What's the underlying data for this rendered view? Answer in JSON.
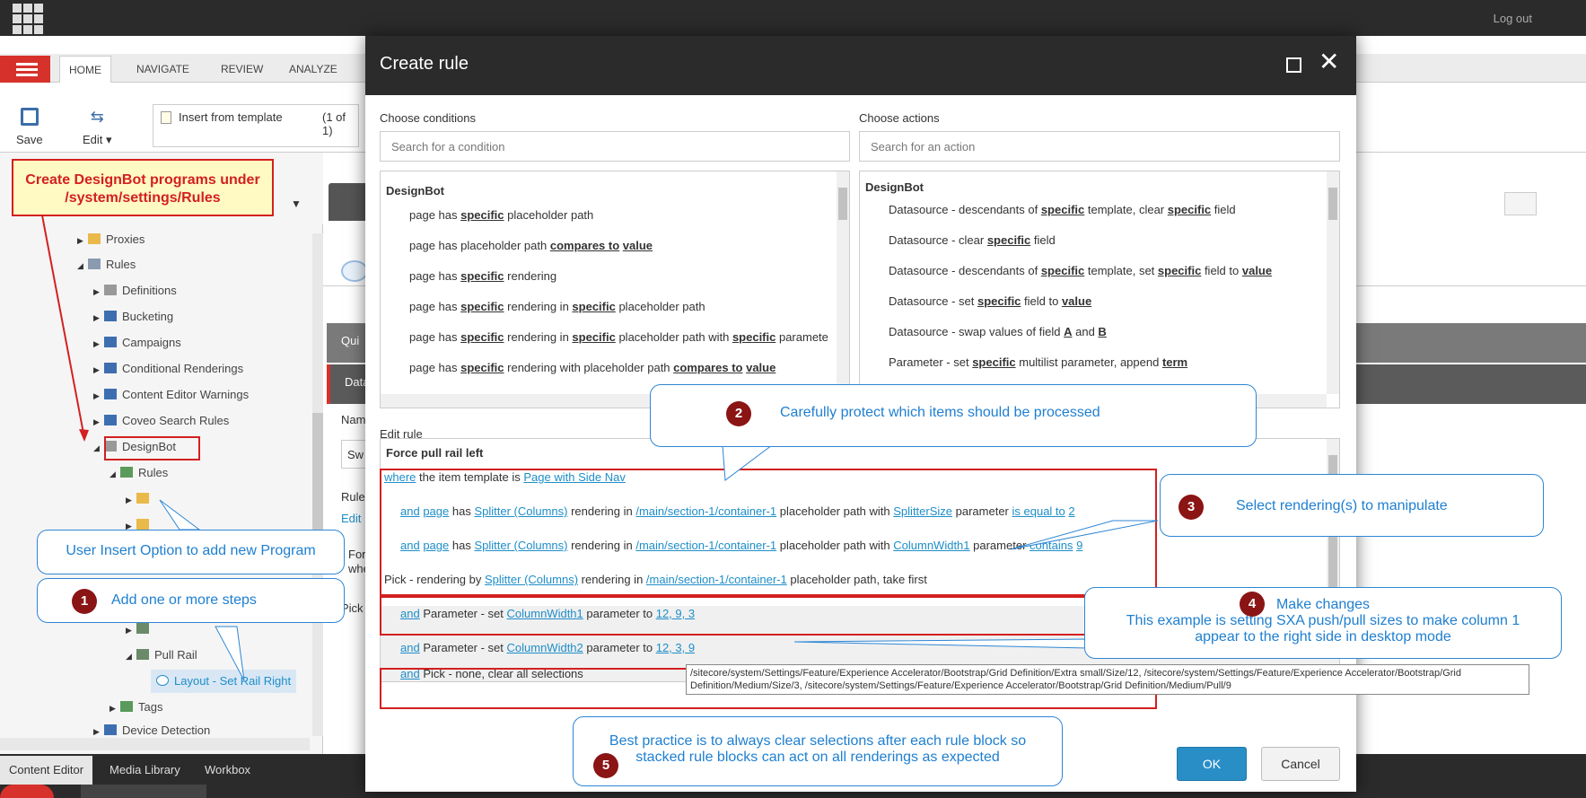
{
  "topbar": {
    "logout": "Log out"
  },
  "ribbon": {
    "tabs": [
      "HOME",
      "NAVIGATE",
      "REVIEW",
      "ANALYZE"
    ],
    "save": "Save",
    "edit": "Edit ▾",
    "insert_template": "Insert from template",
    "insert_count": "(1 of 1)"
  },
  "tree": {
    "items": [
      {
        "label": "Proxies"
      },
      {
        "label": "Rules"
      },
      {
        "label": "Definitions"
      },
      {
        "label": "Bucketing"
      },
      {
        "label": "Campaigns"
      },
      {
        "label": "Conditional Renderings"
      },
      {
        "label": "Content Editor Warnings"
      },
      {
        "label": "Coveo Search Rules"
      },
      {
        "label": "DesignBot"
      },
      {
        "label": "Rules"
      },
      {
        "label": "Pull Rail"
      },
      {
        "label": "Layout - Set Rail Right"
      },
      {
        "label": "Tags"
      },
      {
        "label": "Device Detection"
      }
    ]
  },
  "bottom_tabs": [
    "Content Editor",
    "Media Library",
    "Workbox"
  ],
  "right_fragments": {
    "qui": "Qui",
    "dat": "Data",
    "nam": "Nam",
    "sw": "Sw",
    "rule": "Rule",
    "edit": "Edit",
    "for": "For",
    "whe": "whe",
    "pick": "Pick"
  },
  "modal": {
    "title": "Create rule",
    "choose_conditions": "Choose conditions",
    "choose_actions": "Choose actions",
    "cond_placeholder": "Search for a condition",
    "act_placeholder": "Search for an action",
    "cond_group": "DesignBot",
    "act_group": "DesignBot",
    "edit_rule_label": "Edit rule",
    "rule_name": "Force pull rail left",
    "ok": "OK",
    "cancel": "Cancel"
  },
  "conditions": [
    [
      "page has ",
      "specific",
      " placeholder path"
    ],
    [
      "page has placeholder path ",
      "compares to",
      " ",
      "value"
    ],
    [
      "page has ",
      "specific",
      " rendering"
    ],
    [
      "page has ",
      "specific",
      " rendering in ",
      "specific",
      " placeholder path"
    ],
    [
      "page has ",
      "specific",
      " rendering in ",
      "specific",
      " placeholder path with ",
      "specific",
      " paramete"
    ],
    [
      "page has ",
      "specific",
      " rendering with placeholder path ",
      "compares to",
      " ",
      "value"
    ]
  ],
  "actions": [
    [
      "Datasource - descendants of ",
      "specific",
      " template, clear ",
      "specific",
      " field"
    ],
    [
      "Datasource - clear ",
      "specific",
      " field"
    ],
    [
      "Datasource - descendants of ",
      "specific",
      " template, set ",
      "specific",
      " field to ",
      "value"
    ],
    [
      "Datasource - set ",
      "specific",
      " field to ",
      "value"
    ],
    [
      "Datasource - swap values of field ",
      "A",
      " and ",
      "B"
    ],
    [
      "Parameter - set ",
      "specific",
      " multilist parameter, append ",
      "term"
    ]
  ],
  "rule": {
    "l1": {
      "where": "where",
      "t1": " the item template is ",
      "v1": "Page with Side Nav"
    },
    "l2": {
      "and": "and",
      "page": "page",
      "t1": " has ",
      "r": "Splitter (Columns)",
      "t2": " rendering in ",
      "p": "/main/section-1/container-1",
      "t3": " placeholder path with ",
      "param": "SplitterSize",
      "t4": " parameter ",
      "op": "is equal to",
      "val": "2"
    },
    "l3": {
      "and": "and",
      "page": "page",
      "t1": " has ",
      "r": "Splitter (Columns)",
      "t2": " rendering in ",
      "p": "/main/section-1/container-1",
      "t3": " placeholder path with ",
      "param": "ColumnWidth1",
      "t4": " parameter ",
      "op": "contains",
      "val": "9"
    },
    "l4": {
      "t0": "Pick - rendering by ",
      "r": "Splitter (Columns)",
      "t1": " rendering in ",
      "p": "/main/section-1/container-1",
      "t2": " placeholder path, take first"
    },
    "l5": {
      "and": "and",
      "t1": " Parameter - set ",
      "param": "ColumnWidth1",
      "t2": " parameter to ",
      "val": "12, 9, 3"
    },
    "l6": {
      "and": "and",
      "t1": " Parameter - set ",
      "param": "ColumnWidth2",
      "t2": " parameter to ",
      "val": "12, 3, 9"
    },
    "l7": {
      "and": "and",
      "t1": " Pick - none, clear all selections"
    }
  },
  "tooltip": "/sitecore/system/Settings/Feature/Experience Accelerator/Bootstrap/Grid Definition/Extra small/Size/12, /sitecore/system/Settings/Feature/Experience Accelerator/Bootstrap/Grid Definition/Medium/Size/3, /sitecore/system/Settings/Feature/Experience Accelerator/Bootstrap/Grid Definition/Medium/Pull/9",
  "annotations": {
    "note": "Create DesignBot programs under /system/settings/Rules",
    "insert_option": "User Insert Option to add new Program",
    "c1": {
      "n": "1",
      "text": "Add one or more steps"
    },
    "c2": {
      "n": "2",
      "text": "Carefully protect which items should be processed"
    },
    "c3": {
      "n": "3",
      "text": "Select rendering(s) to manipulate"
    },
    "c4": {
      "n": "4",
      "title": "Make changes",
      "text": "This example is setting SXA push/pull sizes to make column 1 appear to the right side in desktop mode"
    },
    "c5": {
      "n": "5",
      "text": "Best practice is to always clear selections after each rule block so stacked rule blocks can act on all renderings as expected"
    }
  },
  "colors": {
    "accent_red": "#d7312c",
    "link_blue": "#1e8ec8",
    "callout_blue": "#1e7fd0",
    "ok_button": "#2a8ec6"
  }
}
